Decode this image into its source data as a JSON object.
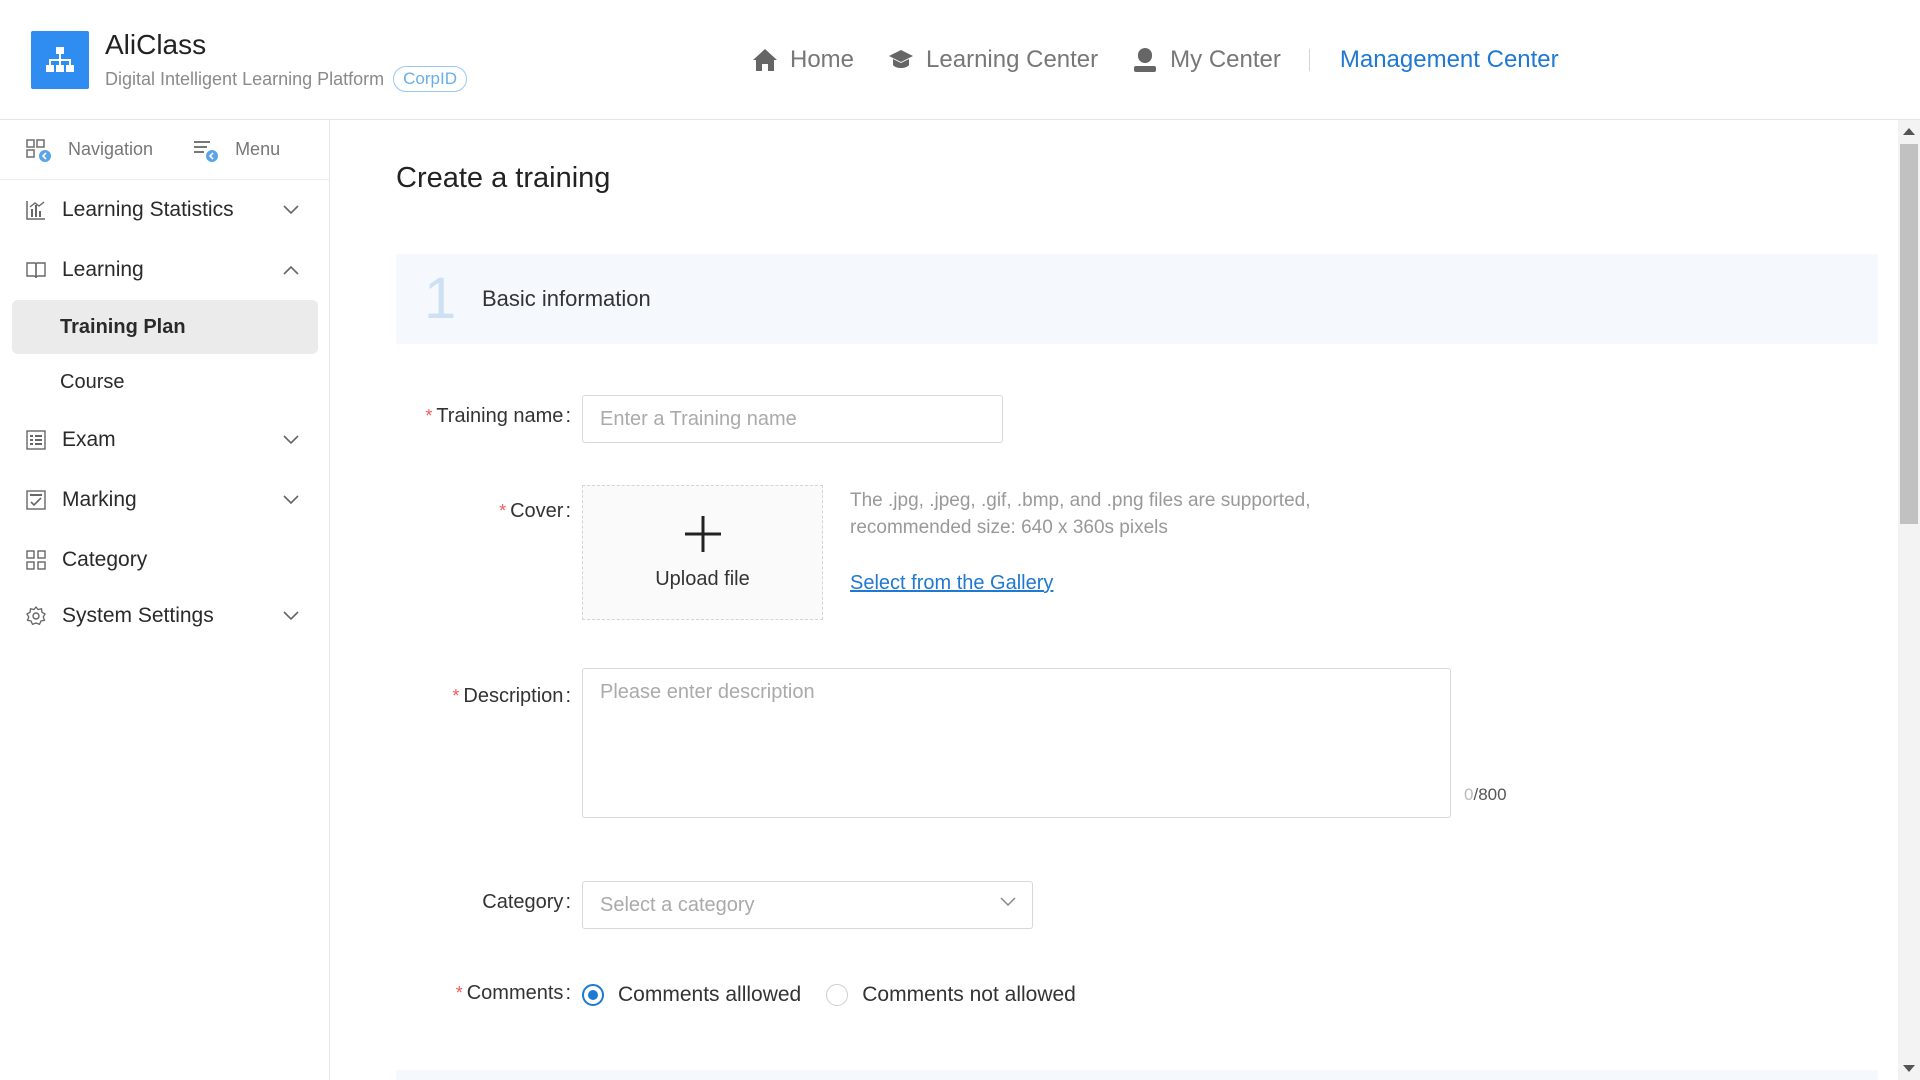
{
  "header": {
    "brand_title": "AliClass",
    "brand_subtitle": "Digital Intelligent Learning Platform",
    "corp_badge": "CorpID",
    "nav": [
      {
        "label": "Home",
        "icon": "home-icon"
      },
      {
        "label": "Learning Center",
        "icon": "graduation-cap-icon"
      },
      {
        "label": "My Center",
        "icon": "user-icon"
      }
    ],
    "nav_active": "Management Center",
    "accent_color": "#1f78d1",
    "logo_color": "#2f8cf0"
  },
  "sidebar": {
    "tabs": [
      {
        "label": "Navigation",
        "icon": "navigation-icon"
      },
      {
        "label": "Menu",
        "icon": "menu-icon"
      }
    ],
    "items": [
      {
        "label": "Learning Statistics",
        "icon": "bar-chart-icon",
        "expanded": false
      },
      {
        "label": "Learning",
        "icon": "book-icon",
        "expanded": true,
        "children": [
          {
            "label": "Training Plan",
            "active": true
          },
          {
            "label": "Course",
            "active": false
          }
        ]
      },
      {
        "label": "Exam",
        "icon": "exam-icon",
        "expanded": false
      },
      {
        "label": "Marking",
        "icon": "marking-icon",
        "expanded": false
      },
      {
        "label": "Category",
        "icon": "grid-icon",
        "expanded": false
      },
      {
        "label": "System Settings",
        "icon": "gear-icon",
        "expanded": false
      }
    ]
  },
  "main": {
    "page_title": "Create a training",
    "section": {
      "number": "1",
      "label": "Basic information"
    },
    "form": {
      "training_name": {
        "label": "Training name",
        "colon": ":",
        "required": true,
        "placeholder": "Enter a Training name"
      },
      "cover": {
        "label": "Cover",
        "colon": ":",
        "required": true,
        "upload_label": "Upload file",
        "hint_line1": "The .jpg, .jpeg, .gif, .bmp, and .png files are supported,",
        "hint_line2": "recommended size: 640 x 360s pixels",
        "gallery_link": "Select from the Gallery"
      },
      "description": {
        "label": "Description",
        "colon": ":",
        "required": true,
        "placeholder": "Please enter description",
        "count_current": "0",
        "count_max": "/800"
      },
      "category": {
        "label": "Category",
        "colon": ":",
        "required": false,
        "placeholder": "Select a category"
      },
      "comments": {
        "label": "Comments",
        "colon": ":",
        "required": true,
        "options": [
          {
            "label": "Comments alllowed",
            "selected": true
          },
          {
            "label": "Comments not allowed",
            "selected": false
          }
        ]
      }
    }
  }
}
